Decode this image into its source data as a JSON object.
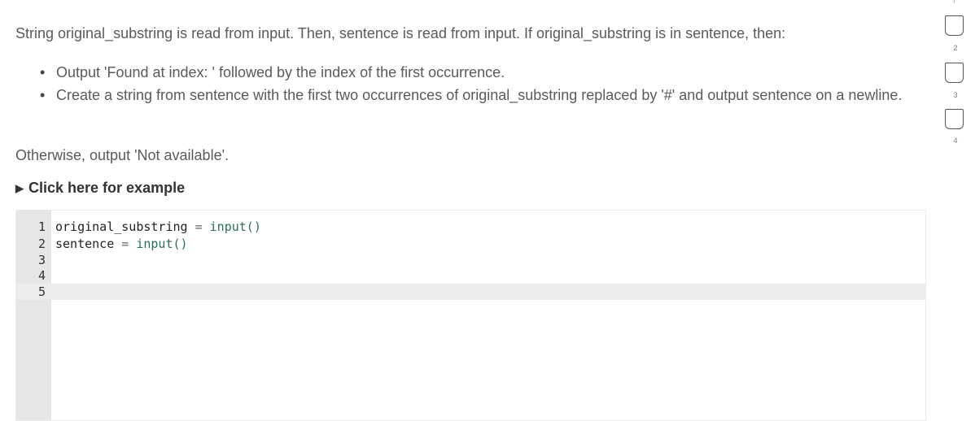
{
  "prompt": {
    "intro": "String original_substring is read from input. Then, sentence is read from input. If original_substring is in sentence, then:",
    "steps": [
      "Output 'Found at index: ' followed by the index of the first occurrence.",
      "Create a string from sentence with the first two occurrences of original_substring replaced by '#' and output sentence on a newline."
    ],
    "otherwise": "Otherwise, output 'Not available'.",
    "example_toggle": "Click here for example"
  },
  "editor": {
    "lines": [
      {
        "number": "1",
        "var": "original_substring",
        "op": " = ",
        "call": "input()"
      },
      {
        "number": "2",
        "var": "sentence",
        "op": " = ",
        "call": "input()"
      },
      {
        "number": "3",
        "var": "",
        "op": "",
        "call": ""
      },
      {
        "number": "4",
        "var": "",
        "op": "",
        "call": ""
      },
      {
        "number": "5",
        "var": "",
        "op": "",
        "call": ""
      }
    ],
    "active_line": 5
  },
  "progress_checks": [
    {
      "label": "2",
      "checked": false
    },
    {
      "label": "3",
      "checked": false
    },
    {
      "label": "4",
      "checked": false
    }
  ]
}
